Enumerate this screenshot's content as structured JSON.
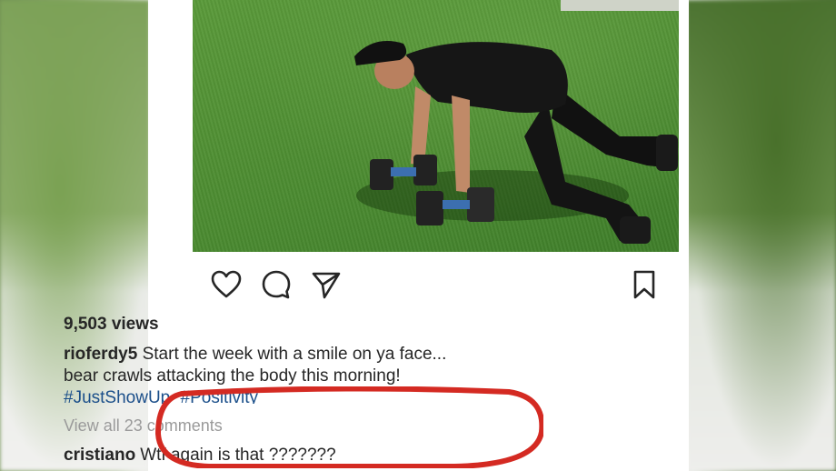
{
  "post": {
    "views": "9,503 views",
    "caption": {
      "username": "rioferdy5",
      "line1": "Start the week with a smile on ya face...",
      "line2": "bear crawls attacking the body this morning!"
    },
    "hashtags": [
      "#JustShowUp",
      "#Positivity"
    ],
    "view_comments_label": "View all 23 comments",
    "comment": {
      "username": "cristiano",
      "text": "Wtf again is that ???????"
    }
  },
  "icons": {
    "like": "heart-icon",
    "comment": "comment-bubble-icon",
    "share": "paper-plane-icon",
    "save": "bookmark-icon"
  },
  "colors": {
    "text": "#262626",
    "muted": "#9a9a9a",
    "hashtag": "#1b4f8a",
    "annotation": "#d42a22",
    "grass": "#4f8f33"
  }
}
